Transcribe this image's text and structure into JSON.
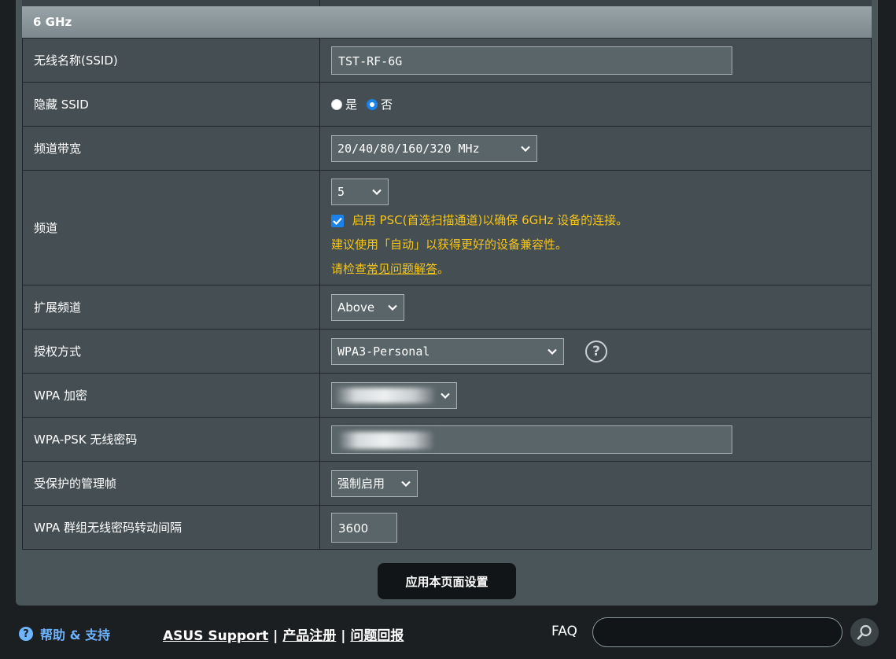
{
  "section": {
    "title": "6 GHz"
  },
  "rows": {
    "ssid": {
      "label": "无线名称(SSID)",
      "value": "TST-RF-6G"
    },
    "hide_ssid": {
      "label": "隐藏 SSID",
      "yes": "是",
      "no": "否",
      "selected": "否"
    },
    "bandwidth": {
      "label": "频道带宽",
      "value": "20/40/80/160/320 MHz"
    },
    "channel": {
      "label": "频道",
      "value": "5",
      "psc_label": "启用 PSC(首选扫描通道)以确保 6GHz 设备的连接。",
      "psc_checked": true,
      "advice": "建议使用「自动」以获得更好的设备兼容性。",
      "faq_prefix": "请检查",
      "faq_link": "常见问题解答",
      "faq_suffix": "。"
    },
    "ext_channel": {
      "label": "扩展频道",
      "value": "Above"
    },
    "auth": {
      "label": "授权方式",
      "value": "WPA3-Personal",
      "help_icon": "?"
    },
    "wpa_encryption": {
      "label": "WPA 加密"
    },
    "wpa_psk": {
      "label": "WPA-PSK 无线密码"
    },
    "pmf": {
      "label": "受保护的管理帧",
      "value": "强制启用"
    },
    "rekey": {
      "label": "WPA 群组无线密码转动间隔",
      "value": "3600"
    }
  },
  "apply_button": "应用本页面设置",
  "footer": {
    "help_icon": "?",
    "help": "帮助 & 支持",
    "asus_support": "ASUS Support",
    "sep1": "|",
    "product_reg": "产品注册",
    "sep2": "|",
    "feedback": "问题回报",
    "faq": "FAQ",
    "faq_input_value": ""
  },
  "colors": {
    "accent_blue": "#1a82e8",
    "warning_yellow": "#f5c518",
    "panel": "#454f53",
    "header": "#8c979b"
  }
}
